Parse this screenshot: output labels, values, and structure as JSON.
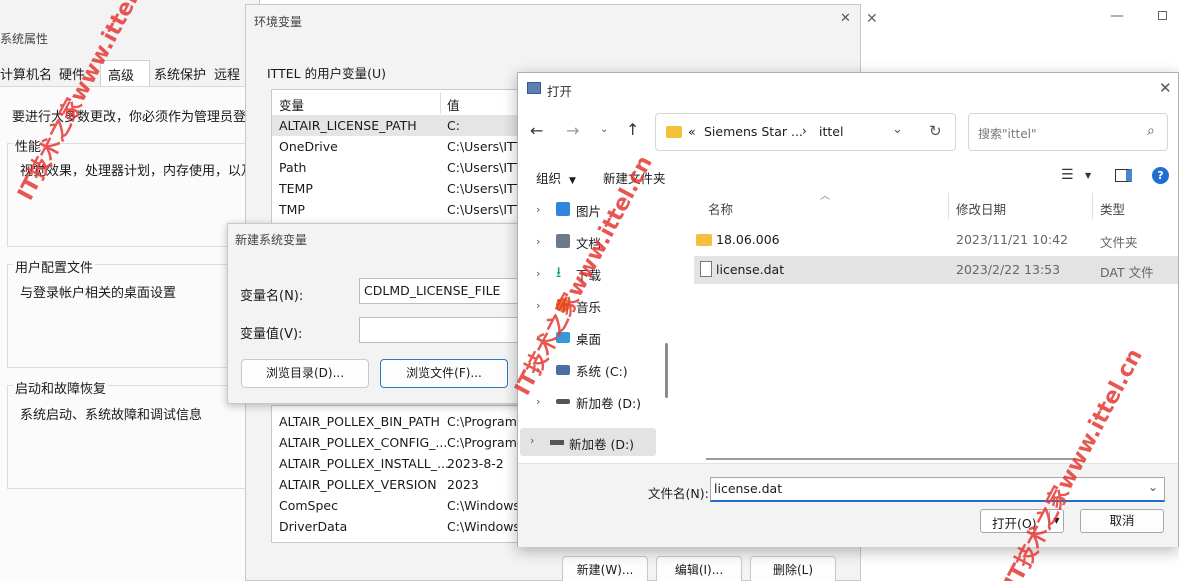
{
  "sysprops": {
    "title": "系统属性",
    "tabs": [
      "计算机名",
      "硬件",
      "高级",
      "系统保护",
      "远程"
    ],
    "admin_note": "要进行大多数更改，你必须作为管理员登录。",
    "perf_label": "性能",
    "perf_desc": "视觉效果，处理器计划，内存使用，以及虚",
    "profile_label": "用户配置文件",
    "profile_desc": "与登录帐户相关的桌面设置",
    "startup_label": "启动和故障恢复",
    "startup_desc": "系统启动、系统故障和调试信息"
  },
  "envvars": {
    "title": "环境变量",
    "user_vars_label": "ITTEL 的用户变量(U)",
    "col_var": "变量",
    "col_val": "值",
    "user_rows": [
      {
        "name": "ALTAIR_LICENSE_PATH",
        "value": "C:"
      },
      {
        "name": "OneDrive",
        "value": "C:\\Users\\ITT"
      },
      {
        "name": "Path",
        "value": "C:\\Users\\ITT"
      },
      {
        "name": "TEMP",
        "value": "C:\\Users\\ITT"
      },
      {
        "name": "TMP",
        "value": "C:\\Users\\ITT"
      }
    ],
    "sys_rows": [
      {
        "name": "ALTAIR_POLLEX_BIN_PATH",
        "value": "C:\\Program"
      },
      {
        "name": "ALTAIR_POLLEX_CONFIG_...",
        "value": "C:\\ProgramD"
      },
      {
        "name": "ALTAIR_POLLEX_INSTALL_...",
        "value": "2023-8-2"
      },
      {
        "name": "ALTAIR_POLLEX_VERSION",
        "value": "2023"
      },
      {
        "name": "ComSpec",
        "value": "C:\\Windows\\"
      },
      {
        "name": "DriverData",
        "value": "C:\\Windows\\"
      }
    ],
    "new_btn": "新建(W)...",
    "edit_btn": "编辑(I)...",
    "delete_btn": "删除(L)"
  },
  "newvar": {
    "title": "新建系统变量",
    "name_label": "变量名(N):",
    "name_value": "CDLMD_LICENSE_FILE",
    "value_label": "变量值(V):",
    "value_value": "",
    "browse_dir": "浏览目录(D)...",
    "browse_file": "浏览文件(F)..."
  },
  "opendlg": {
    "title": "打开",
    "breadcrumb": [
      "«",
      "Siemens Star ...",
      "ittel"
    ],
    "search_placeholder": "搜索\"ittel\"",
    "organize": "组织",
    "new_folder": "新建文件夹",
    "nav": [
      {
        "label": "图片",
        "icon": "pictures-icon",
        "color": "#2e86de"
      },
      {
        "label": "文档",
        "icon": "documents-icon",
        "color": "#6c7a89"
      },
      {
        "label": "下载",
        "icon": "downloads-icon",
        "color": "#16a085"
      },
      {
        "label": "音乐",
        "icon": "music-icon",
        "color": "#e67e22"
      },
      {
        "label": "桌面",
        "icon": "desktop-icon",
        "color": "#3498db"
      },
      {
        "label": "系统 (C:)",
        "icon": "drive-c-icon",
        "color": "#4a6fa5"
      },
      {
        "label": "新加卷 (D:)",
        "icon": "drive-d-icon",
        "color": "#555555"
      }
    ],
    "nav_selected": "新加卷 (D:)",
    "col_name": "名称",
    "col_date": "修改日期",
    "col_type": "类型",
    "files": [
      {
        "name": "18.06.006",
        "date": "2023/11/21 10:42",
        "type": "文件夹",
        "icon": "folder-icon"
      },
      {
        "name": "license.dat",
        "date": "2023/2/22 13:53",
        "type": "DAT 文件",
        "icon": "file-icon"
      }
    ],
    "filename_label": "文件名(N):",
    "filename_value": "license.dat",
    "open_btn": "打开(O)",
    "cancel_btn": "取消"
  },
  "watermark": "IT技术之家www.ittel.cn"
}
